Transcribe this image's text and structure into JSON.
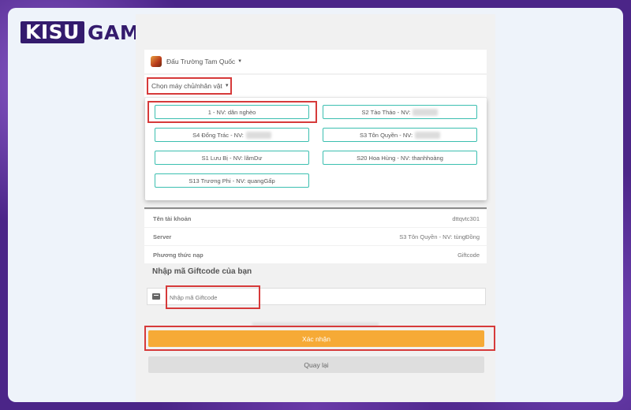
{
  "logo": {
    "part1": "KISU",
    "part2": "GAME"
  },
  "header": {
    "game_name": "Đấu Trường Tam Quốc"
  },
  "server_select": {
    "label": "Chọn máy chủ/nhân vật"
  },
  "server_options": [
    {
      "label": "1 - NV: dân nghèo",
      "redacted": false
    },
    {
      "label": "S2 Tào Tháo - NV:",
      "redacted": true
    },
    {
      "label": "S4 Đổng Trác - NV:",
      "redacted": true
    },
    {
      "label": "S3 Tôn Quyền - NV:",
      "redacted": true
    },
    {
      "label": "S1 Lưu Bị - NV: lãmDư",
      "redacted": false
    },
    {
      "label": "S20 Hoa Hùng - NV: thanhhoàng",
      "redacted": false
    },
    {
      "label": "S13 Trương Phi - NV: quangGấp",
      "redacted": false
    }
  ],
  "account_info": [
    {
      "label": "Tên tài khoản",
      "value": "dttqvtc301"
    },
    {
      "label": "Server",
      "value": "S3 Tôn Quyền - NV: tùngĐồng"
    },
    {
      "label": "Phương thức nạp",
      "value": "Giftcode"
    }
  ],
  "giftcode": {
    "title": "Nhập mã Giftcode của bạn",
    "placeholder": "Nhập mã Giftcode"
  },
  "buttons": {
    "confirm": "Xác nhận",
    "back": "Quay lại"
  },
  "colors": {
    "accent": "#f6aa36",
    "option_border": "#3cbfb0",
    "highlight": "#d63a3a",
    "logo_bg": "#341b6d"
  }
}
